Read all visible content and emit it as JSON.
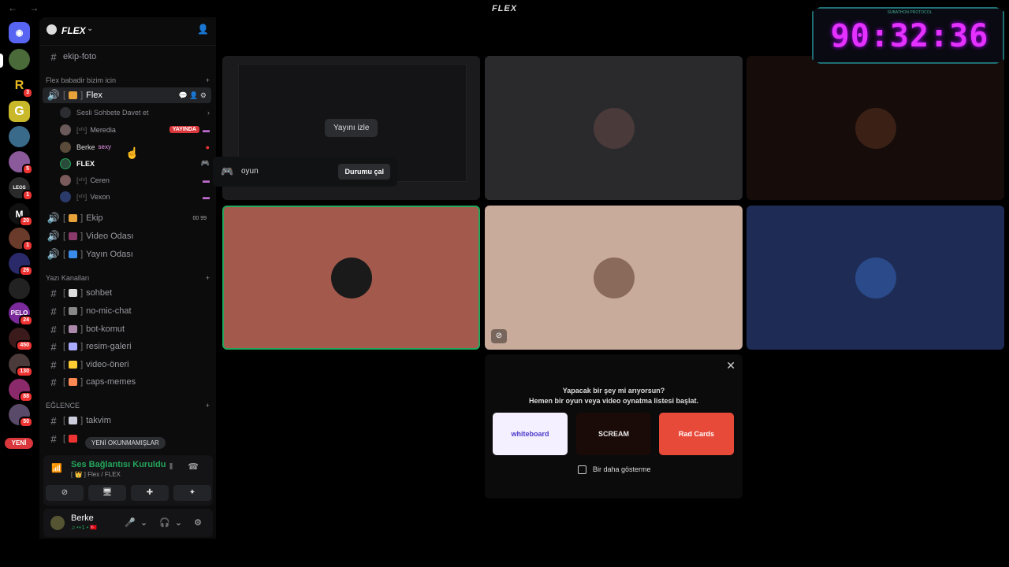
{
  "window": {
    "title": "FLEX",
    "nav": "← →"
  },
  "server_rail": {
    "badges": [
      "3",
      "5",
      "1",
      "20",
      "1",
      "26",
      "24",
      "450",
      "130",
      "88",
      "50"
    ],
    "new_label": "YENİ",
    "letters": [
      "R",
      "G",
      "M",
      "LEOS"
    ]
  },
  "sidebar": {
    "server_name": "FLEX",
    "top_channel": "ekip-foto",
    "category_voice": "Flex babadir bizim icin",
    "voice_channels": [
      {
        "name": "Flex",
        "bracket": "[ ]"
      },
      {
        "name": "Ekip",
        "bracket": "[ ]",
        "counts": [
          "00",
          "99"
        ]
      },
      {
        "name": "Video Odası",
        "bracket": "[ ]"
      },
      {
        "name": "Yayın Odası",
        "bracket": "[ ]"
      }
    ],
    "invite_label": "Sesli Sohbete Davet et",
    "voice_users": [
      {
        "name": "Meredia",
        "tag": "[ⁿᶠˣ]",
        "status": "YAYINDA"
      },
      {
        "name": "Berke",
        "tag": "",
        "extra": "sexy"
      },
      {
        "name": "FLEX",
        "tag": ""
      },
      {
        "name": "Ceren",
        "tag": "[ⁿᶠˣ]"
      },
      {
        "name": "Vexon",
        "tag": "[ⁿᶠˣ]"
      }
    ],
    "category_text": "Yazı Kanalları",
    "text_channels": [
      "sohbet",
      "no-mic-chat",
      "bot-komut",
      "resim-galeri",
      "video-öneri",
      "caps-memes"
    ],
    "category_fun": "EĞLENCE",
    "fun_channels": [
      "takvim"
    ],
    "unread_label": "YENİ OKUNMAMIŞLAR"
  },
  "voice_panel": {
    "status": "Ses Bağlantısı Kuruldu",
    "sub": "[ 👑 ] Flex / FLEX"
  },
  "user_panel": {
    "name": "Berke",
    "status": "♫ •+1 • 🇹🇷"
  },
  "stage": {
    "watch_label": "Yayını izle",
    "tile_colors": [
      "#1b1b1d",
      "#2a2a2c",
      "#160d0b",
      "#a35a4d",
      "#c9ab9c",
      "#1e2c55"
    ]
  },
  "game_popup": {
    "label": "oyun",
    "button": "Durumu çal"
  },
  "activity": {
    "line1": "Yapacak bir şey mi arıyorsun?",
    "line2": "Hemen bir oyun veya video oynatma listesi başlat.",
    "cards": [
      "whiteboard",
      "SCREAM",
      "Rad Cards"
    ],
    "checkbox": "Bir daha gösterme"
  },
  "timer": {
    "value": "90:32:36",
    "caption": "SUBATHON PROTOCOL"
  }
}
